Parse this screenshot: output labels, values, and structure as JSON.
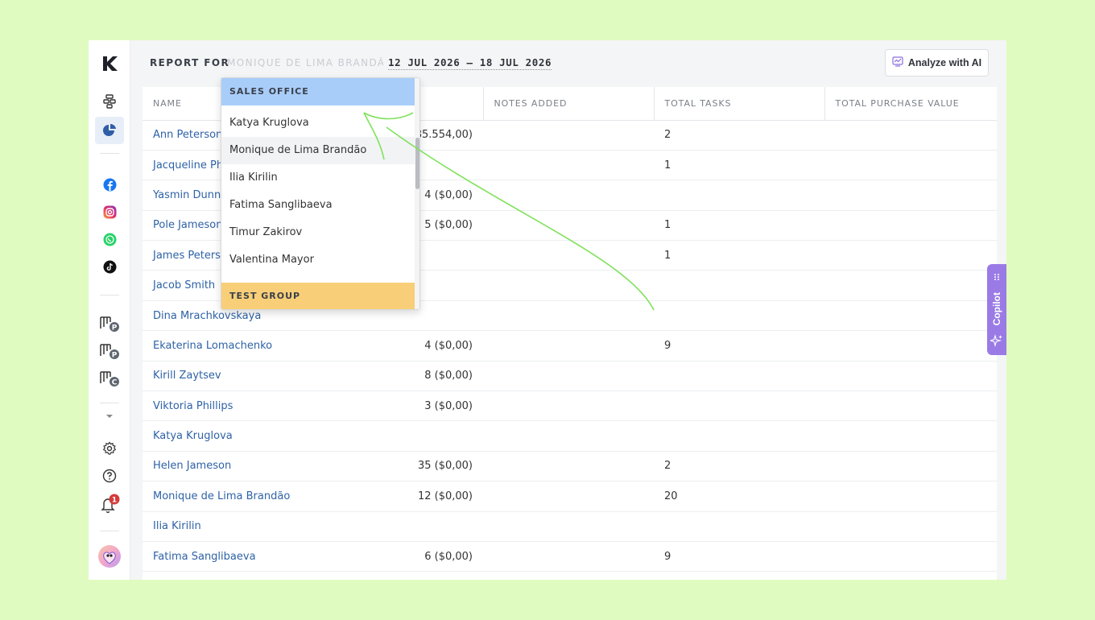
{
  "header": {
    "report_for_label": "REPORT FOR",
    "selected_user": "MONIQUE DE LIMA BRANDÃO",
    "date_range": "12 JUL 2026 — 18 JUL 2026",
    "analyze_button": "Analyze with AI"
  },
  "table": {
    "columns": [
      "NAME",
      "",
      "NOTES ADDED",
      "TOTAL TASKS",
      "TOTAL PURCHASE VALUE"
    ],
    "rows": [
      {
        "name": "Ann Peterson",
        "deals": "585.554,00)",
        "notes": "",
        "tasks": "2",
        "purchase": ""
      },
      {
        "name": "Jacqueline Phillips",
        "deals": "",
        "notes": "",
        "tasks": "1",
        "purchase": ""
      },
      {
        "name": "Yasmin Dunn",
        "deals": "4 ($0,00)",
        "notes": "",
        "tasks": "",
        "purchase": ""
      },
      {
        "name": "Pole Jameson",
        "deals": "5 ($0,00)",
        "notes": "",
        "tasks": "1",
        "purchase": ""
      },
      {
        "name": "James Peterson",
        "deals": "",
        "notes": "",
        "tasks": "1",
        "purchase": ""
      },
      {
        "name": "Jacob Smith",
        "deals": "",
        "notes": "",
        "tasks": "",
        "purchase": ""
      },
      {
        "name": "Dina Mrachkovskaya",
        "deals": "",
        "notes": "",
        "tasks": "",
        "purchase": ""
      },
      {
        "name": "Ekaterina Lomachenko",
        "deals": "4 ($0,00)",
        "notes": "",
        "tasks": "9",
        "purchase": ""
      },
      {
        "name": "Kirill Zaytsev",
        "deals": "8 ($0,00)",
        "notes": "",
        "tasks": "",
        "purchase": ""
      },
      {
        "name": "Viktoria Phillips",
        "deals": "3 ($0,00)",
        "notes": "",
        "tasks": "",
        "purchase": ""
      },
      {
        "name": "Katya Kruglova",
        "deals": "",
        "notes": "",
        "tasks": "",
        "purchase": ""
      },
      {
        "name": "Helen Jameson",
        "deals": "35 ($0,00)",
        "notes": "",
        "tasks": "2",
        "purchase": ""
      },
      {
        "name": "Monique de Lima Brandão",
        "deals": "12 ($0,00)",
        "notes": "",
        "tasks": "20",
        "purchase": ""
      },
      {
        "name": "Ilia Kirilin",
        "deals": "",
        "notes": "",
        "tasks": "",
        "purchase": ""
      },
      {
        "name": "Fatima Sanglibaeva",
        "deals": "6 ($0,00)",
        "notes": "",
        "tasks": "9",
        "purchase": ""
      }
    ]
  },
  "dropdown": {
    "group_sales": "SALES OFFICE",
    "items": [
      "Katya Kruglova",
      "Monique de Lima Brandão",
      "Ilia Kirilin",
      "Fatima Sanglibaeva",
      "Timur Zakirov",
      "Valentina Mayor"
    ],
    "group_test": "TEST GROUP"
  },
  "sidebar": {
    "notification_count": "1",
    "icons": [
      "logo-icon",
      "funnel-icon",
      "reports-icon",
      "facebook-icon",
      "instagram-icon",
      "whatsapp-icon",
      "tiktok-icon",
      "pipeline-p-icon",
      "pipeline-p-icon",
      "pipeline-c-icon",
      "chevron-down-icon",
      "settings-icon",
      "help-icon",
      "bell-icon",
      "avatar"
    ]
  },
  "copilot": {
    "label": "Copilot"
  },
  "colors": {
    "background": "#e0fbc0",
    "link": "#2e62a6",
    "sales_group": "#a9cdf9",
    "test_group": "#f8cf78",
    "copilot": "#9a7be6",
    "badge": "#d43b3b",
    "arrow": "#7fe25a"
  }
}
